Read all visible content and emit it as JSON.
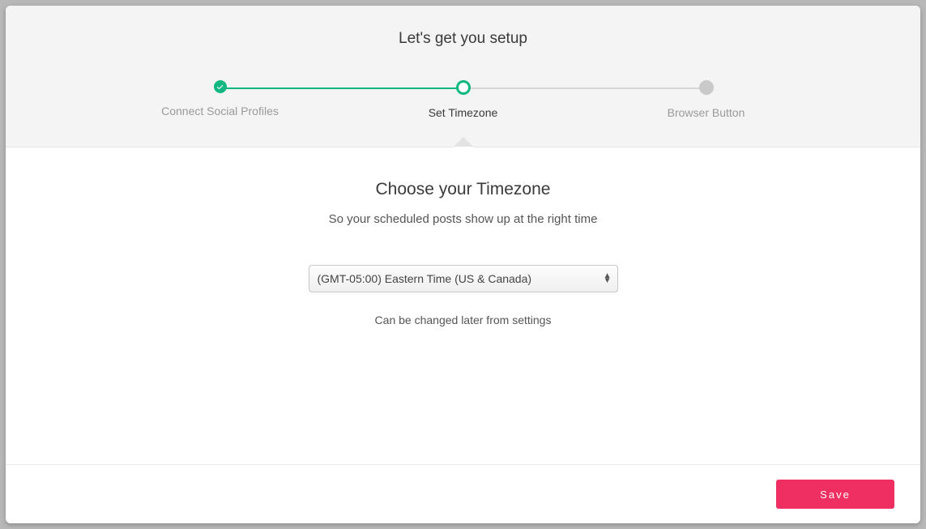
{
  "colors": {
    "accent_green": "#10b781",
    "accent_pink": "#ef2e61"
  },
  "header": {
    "title": "Let's get you setup"
  },
  "stepper": {
    "steps": [
      {
        "label": "Connect Social Profiles",
        "state": "done"
      },
      {
        "label": "Set Timezone",
        "state": "active"
      },
      {
        "label": "Browser Button",
        "state": "pending"
      }
    ]
  },
  "main": {
    "heading": "Choose your Timezone",
    "subheading": "So your scheduled posts show up at the right time",
    "timezone_selected": "(GMT-05:00) Eastern Time (US & Canada)",
    "hint": "Can be changed later from settings"
  },
  "footer": {
    "save_label": "Save"
  }
}
